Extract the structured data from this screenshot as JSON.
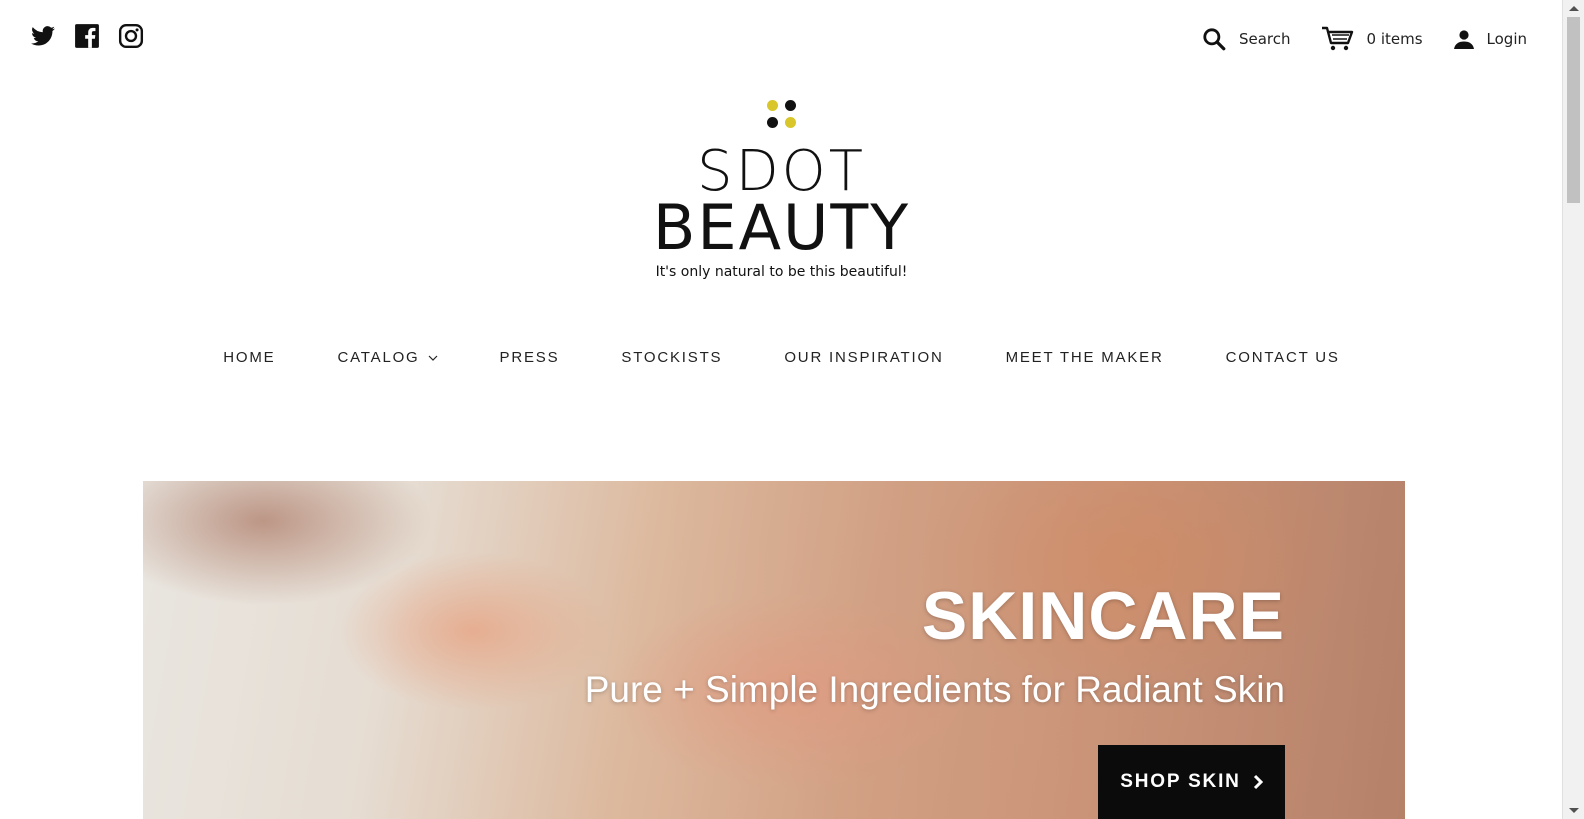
{
  "social": [
    {
      "icon": "twitter-icon"
    },
    {
      "icon": "facebook-icon"
    },
    {
      "icon": "instagram-icon"
    }
  ],
  "utility": {
    "search_label": "Search",
    "cart_label": "0 items",
    "login_label": "Login"
  },
  "logo": {
    "line1": "SDOT",
    "line2": "BEAUTY",
    "tagline": "It's only natural to be this beautiful!",
    "dot_colors": [
      "#d8c62a",
      "#111111",
      "#111111",
      "#d8c62a"
    ]
  },
  "nav": [
    {
      "label": "HOME"
    },
    {
      "label": "CATALOG",
      "has_dropdown": true
    },
    {
      "label": "PRESS"
    },
    {
      "label": "STOCKISTS"
    },
    {
      "label": "OUR INSPIRATION"
    },
    {
      "label": "MEET THE MAKER"
    },
    {
      "label": "CONTACT US"
    }
  ],
  "hero": {
    "title": "SKINCARE",
    "subtitle": "Pure + Simple Ingredients for Radiant Skin",
    "button_label": "SHOP SKIN"
  },
  "colors": {
    "accent_yellow": "#d8c62a",
    "text": "#111111",
    "button_bg": "#0b0b0b"
  }
}
